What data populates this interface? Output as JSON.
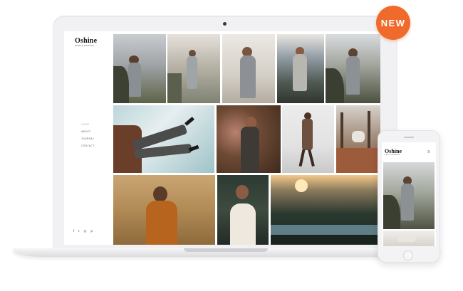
{
  "badge": {
    "label": "NEW",
    "color": "#f06a2c"
  },
  "site": {
    "brand": "Oshine",
    "tagline": "PHOTOGRAPHY",
    "nav": [
      {
        "label": "HOME",
        "active": true
      },
      {
        "label": "ABOUT",
        "active": false
      },
      {
        "label": "JOURNAL",
        "active": false
      },
      {
        "label": "CONTACT",
        "active": false
      }
    ],
    "social_icons": [
      "facebook-icon",
      "twitter-icon",
      "instagram-icon",
      "pinterest-icon"
    ],
    "social_glyphs": [
      "f",
      "t",
      "◎",
      "p"
    ],
    "menu_glyph": "≡"
  },
  "gallery": {
    "photos": [
      "woman-in-grey-dress-field",
      "woman-back-view-path",
      "woman-in-slip-dress",
      "woman-in-dress-hilltop",
      "woman-in-grey-dress-trees",
      "legs-in-heels-on-chair",
      "woman-among-flowers",
      "woman-walking-studio",
      "woman-by-lake",
      "woman-in-dry-grass",
      "woman-in-white-dress",
      "forest-lake-sunset"
    ]
  }
}
